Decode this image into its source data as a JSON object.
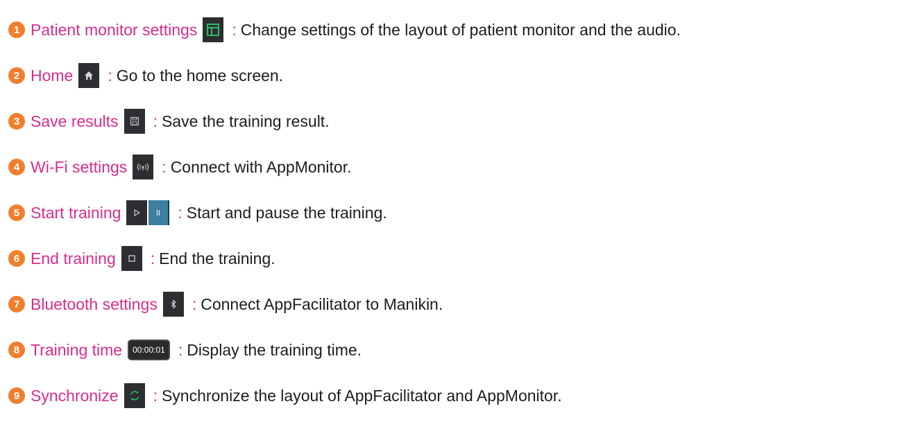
{
  "colors": {
    "accent": "#d62d8b",
    "number_badge": "#f07f2d",
    "icon_bg": "#2c2e31",
    "pause_bg": "#3d7fa0",
    "layout_icon": "#27c060",
    "sync_icon": "#27c060"
  },
  "items": [
    {
      "number": "1",
      "term": "Patient monitor settings",
      "icon": "layout-icon",
      "colon": ":",
      "description": "Change settings of the layout of patient monitor and the audio."
    },
    {
      "number": "2",
      "term": "Home",
      "icon": "home-icon",
      "colon": ":",
      "description": "Go to the home screen."
    },
    {
      "number": "3",
      "term": "Save results",
      "icon": "save-icon",
      "colon": ":",
      "description": "Save the training result."
    },
    {
      "number": "4",
      "term": "Wi-Fi settings",
      "icon": "wifi-icon",
      "colon": ":",
      "description": "Connect with AppMonitor."
    },
    {
      "number": "5",
      "term": "Start training",
      "icon": "play-pause-icon",
      "colon": ":",
      "description": "Start and pause the training."
    },
    {
      "number": "6",
      "term": "End training",
      "icon": "stop-icon",
      "colon": ":",
      "description": "End the training."
    },
    {
      "number": "7",
      "term": "Bluetooth settings",
      "icon": "bluetooth-icon",
      "colon": ":",
      "description": "Connect AppFacilitator to Manikin."
    },
    {
      "number": "8",
      "term": "Training time",
      "icon": "timer-display",
      "icon_text": "00:00:01",
      "colon": ":",
      "description": "Display the training time."
    },
    {
      "number": "9",
      "term": "Synchronize",
      "icon": "sync-icon",
      "colon": ":",
      "description": "Synchronize the layout of AppFacilitator and AppMonitor."
    }
  ]
}
